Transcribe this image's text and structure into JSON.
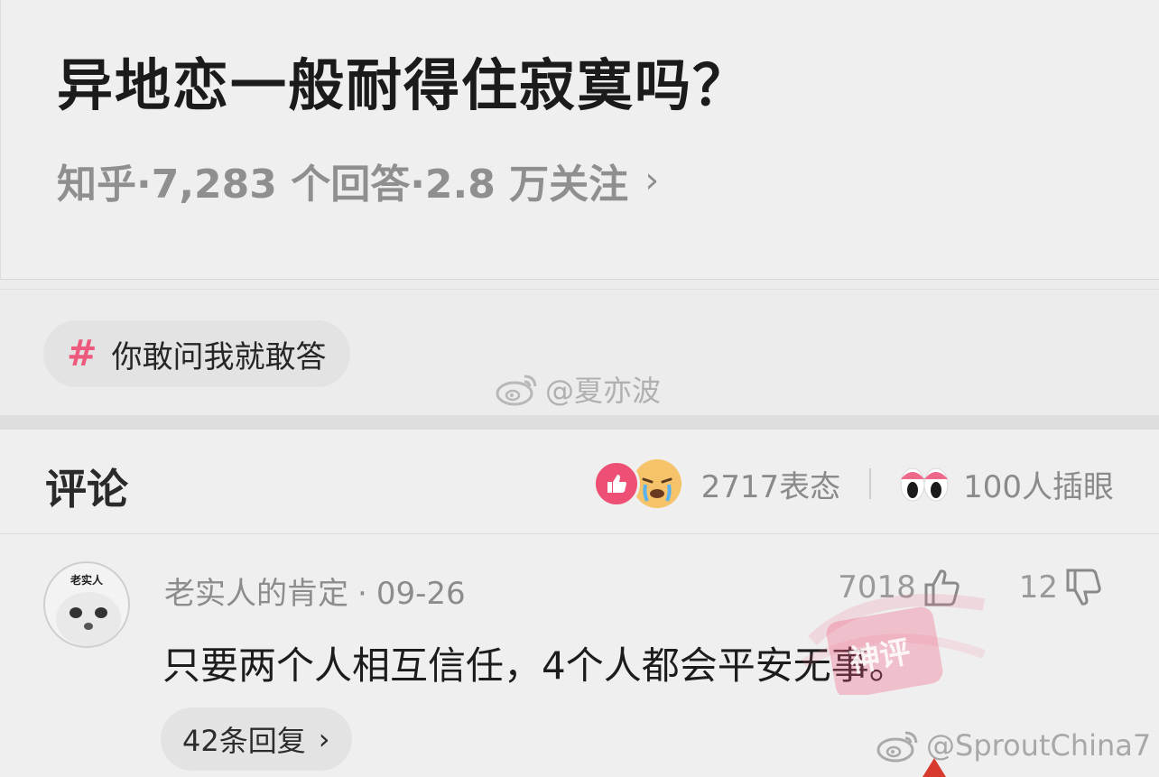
{
  "question": {
    "title": "异地恋一般耐得住寂寞吗？",
    "meta": "知乎·7,283 个回答·2.8 万关注",
    "meta_chevron": "›"
  },
  "topic": {
    "hash": "#",
    "label": "你敢问我就敢答"
  },
  "watermarks": {
    "top": "@夏亦波",
    "bottom": "@SproutChina7",
    "stamp": "神评"
  },
  "comments_header": {
    "title": "评论",
    "reaction_count": "2717表态",
    "eyes_count": "100人插眼"
  },
  "comment": {
    "avatar_text": "老实人",
    "author": "老实人的肯定",
    "dot": "·",
    "date": "09-26",
    "body": "只要两个人相互信任，4个人都会平安无事。",
    "likes": "7018",
    "dislikes": "12",
    "replies": "42条回复",
    "replies_chevron": "›"
  },
  "colors": {
    "accent_pink": "#ee4f74",
    "hash_pink": "#ee5a7e",
    "muted_gray": "#8f8f8f"
  },
  "icons": [
    "hash-icon",
    "like-reaction-icon",
    "cry-reaction-icon",
    "eyes-icon",
    "thumbs-up-icon",
    "thumbs-down-icon",
    "weibo-logo-icon",
    "chevron-right-icon"
  ]
}
